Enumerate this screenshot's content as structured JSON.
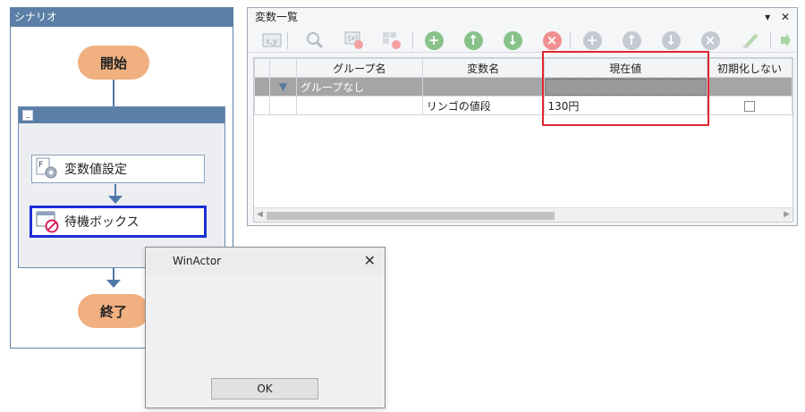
{
  "scenario": {
    "title": "シナリオ",
    "start_label": "開始",
    "end_label": "終了",
    "nodes": [
      {
        "label": "変数値設定",
        "icon": "variable-set-icon"
      },
      {
        "label": "待機ボックス",
        "icon": "wait-box-icon"
      }
    ]
  },
  "variable_panel": {
    "title": "変数一覧",
    "pin_glyph": "▾",
    "close_glyph": "✕",
    "toolbar_icons": [
      "xy-icon",
      "search-icon",
      "variable-delete-icon",
      "grid-delete-icon",
      "add-icon",
      "up-icon",
      "down-icon",
      "delete-icon",
      "add-gray-icon",
      "up-gray-icon",
      "down-gray-icon",
      "delete-gray-icon",
      "clear-icon",
      "next-icon"
    ],
    "columns": [
      "グループ名",
      "変数名",
      "現在値",
      "初期化しない"
    ],
    "group_row": {
      "group": "グループなし"
    },
    "rows": [
      {
        "group": "",
        "name": "リンゴの値段",
        "value": "130円",
        "no_init": false
      }
    ],
    "highlight_color": "#e0262f"
  },
  "dialog": {
    "title": "WinActor",
    "close_glyph": "✕",
    "ok_label": "OK"
  },
  "colors": {
    "title_blue": "#5b7fa6",
    "pill_orange": "#f0b080",
    "selected_border": "#1a2fd6",
    "group_row_gray": "#a5a5a5"
  }
}
